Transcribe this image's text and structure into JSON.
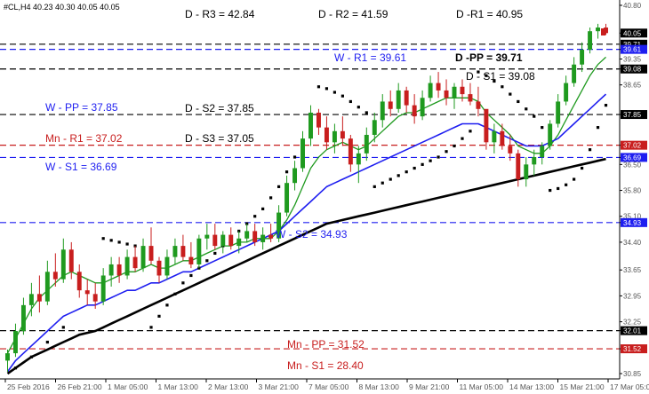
{
  "chart_data": {
    "type": "candlestick",
    "symbol_header": "#CL,H4  40.23 40.30 40.05 40.05",
    "ylim": [
      30.85,
      40.8
    ],
    "y_ticks": [
      "40.80",
      "40.05",
      "39.61",
      "39.35",
      "39.08",
      "38.65",
      "37.85",
      "37.02",
      "36.69",
      "36.50",
      "35.80",
      "35.10",
      "34.93",
      "34.40",
      "33.65",
      "32.95",
      "32.25",
      "32.01",
      "31.52",
      "30.85"
    ],
    "y_tick_values": [
      40.8,
      40.05,
      39.61,
      39.35,
      39.08,
      38.65,
      37.85,
      37.02,
      36.69,
      36.5,
      35.8,
      35.1,
      34.93,
      34.4,
      33.65,
      32.95,
      32.25,
      32.01,
      31.52,
      30.85
    ],
    "highlight_ticks": [
      {
        "label": "40.05",
        "value": 40.05,
        "bg": "#000000",
        "fg": "#ffffff"
      },
      {
        "label": "39.71",
        "value": 39.75,
        "bg": "#000000",
        "fg": "#ffffff"
      },
      {
        "label": "39.61",
        "value": 39.61,
        "bg": "#1e1ef0",
        "fg": "#ffffff"
      },
      {
        "label": "39.08",
        "value": 39.08,
        "bg": "#000000",
        "fg": "#ffffff"
      },
      {
        "label": "37.85",
        "value": 37.85,
        "bg": "#000000",
        "fg": "#ffffff"
      },
      {
        "label": "37.02",
        "value": 37.02,
        "bg": "#c81e1e",
        "fg": "#ffffff"
      },
      {
        "label": "36.69",
        "value": 36.69,
        "bg": "#1e1ef0",
        "fg": "#ffffff"
      },
      {
        "label": "34.93",
        "value": 34.93,
        "bg": "#1e1ef0",
        "fg": "#ffffff"
      },
      {
        "label": "32.01",
        "value": 32.01,
        "bg": "#000000",
        "fg": "#ffffff"
      },
      {
        "label": "31.52",
        "value": 31.52,
        "bg": "#c81e1e",
        "fg": "#ffffff"
      }
    ],
    "x_labels": [
      "25 Feb 2016",
      "26 Feb 21:00",
      "1 Mar 05:00",
      "1 Mar 13:00",
      "2 Mar 13:00",
      "3 Mar 21:00",
      "7 Mar 05:00",
      "8 Mar 13:00",
      "9 Mar 21:00",
      "11 Mar 05:00",
      "14 Mar 13:00",
      "15 Mar 21:00",
      "17 Mar 05:00"
    ],
    "pivot_levels": [
      {
        "label": "D - R3 = 42.84",
        "value": 42.84,
        "color": "#000000",
        "line": false
      },
      {
        "label": "D - R2 = 41.59",
        "value": 41.59,
        "color": "#000000",
        "line": false
      },
      {
        "label": "D -R1 = 40.95",
        "value": 40.95,
        "color": "#000000",
        "line": false
      },
      {
        "label": "D -PP = 39.71",
        "value": 39.75,
        "color": "#000000",
        "line": true,
        "bold": true
      },
      {
        "label": "W - R1 = 39.61",
        "value": 39.61,
        "color": "#1e1ef0",
        "line": true
      },
      {
        "label": "D - S1 = 39.08",
        "value": 39.08,
        "color": "#000000",
        "line": true
      },
      {
        "label": "W - PP = 37.85",
        "value": 37.85,
        "color": "#1e1ef0",
        "line": false
      },
      {
        "label": "D - S2 = 37.85",
        "value": 37.85,
        "color": "#000000",
        "line": true
      },
      {
        "label": "Mn - R1 = 37.02",
        "value": 37.02,
        "color": "#c81e1e",
        "line": true
      },
      {
        "label": "D - S3 = 37.05",
        "value": 37.05,
        "color": "#000000",
        "line": false
      },
      {
        "label": "W - S1 = 36.69",
        "value": 36.69,
        "color": "#1e1ef0",
        "line": true
      },
      {
        "label": "W - S2 = 34.93",
        "value": 34.93,
        "color": "#1e1ef0",
        "line": true
      },
      {
        "label": "Mn - PP = 31.52",
        "value": 31.52,
        "color": "#c81e1e",
        "line": true
      },
      {
        "label": "Mn - S1 = 28.40",
        "value": 28.4,
        "color": "#c81e1e",
        "line": false
      },
      {
        "label": "",
        "value": 32.01,
        "color": "#000000",
        "line": true
      }
    ],
    "candles": [
      [
        31.2,
        31.5,
        30.9,
        31.4
      ],
      [
        31.4,
        32.2,
        31.3,
        32.0
      ],
      [
        32.0,
        32.9,
        31.9,
        32.7
      ],
      [
        32.7,
        33.3,
        32.4,
        33.0
      ],
      [
        33.0,
        33.5,
        32.5,
        32.8
      ],
      [
        32.8,
        33.9,
        32.7,
        33.6
      ],
      [
        33.6,
        34.1,
        33.2,
        33.4
      ],
      [
        33.4,
        34.5,
        33.3,
        34.2
      ],
      [
        34.2,
        34.4,
        33.4,
        33.6
      ],
      [
        33.6,
        33.8,
        32.9,
        33.1
      ],
      [
        33.1,
        33.4,
        32.7,
        33.0
      ],
      [
        33.0,
        33.3,
        32.6,
        32.8
      ],
      [
        32.8,
        33.7,
        32.7,
        33.5
      ],
      [
        33.5,
        34.0,
        33.2,
        33.8
      ],
      [
        33.8,
        34.0,
        33.3,
        33.5
      ],
      [
        33.5,
        34.2,
        33.4,
        34.0
      ],
      [
        34.0,
        34.3,
        33.6,
        33.7
      ],
      [
        33.7,
        34.5,
        33.6,
        34.3
      ],
      [
        34.3,
        34.8,
        33.8,
        33.9
      ],
      [
        33.9,
        34.0,
        33.3,
        33.5
      ],
      [
        33.5,
        34.2,
        33.4,
        34.0
      ],
      [
        34.0,
        34.5,
        33.8,
        34.3
      ],
      [
        34.3,
        34.6,
        33.9,
        34.0
      ],
      [
        34.0,
        34.4,
        33.7,
        33.8
      ],
      [
        33.8,
        34.6,
        33.7,
        34.5
      ],
      [
        34.5,
        34.9,
        34.2,
        34.6
      ],
      [
        34.6,
        34.9,
        34.2,
        34.3
      ],
      [
        34.3,
        34.7,
        34.1,
        34.6
      ],
      [
        34.6,
        34.8,
        34.2,
        34.3
      ],
      [
        34.3,
        34.7,
        34.1,
        34.5
      ],
      [
        34.5,
        34.9,
        34.4,
        34.7
      ],
      [
        34.7,
        34.9,
        34.3,
        34.4
      ],
      [
        34.4,
        34.8,
        34.2,
        34.6
      ],
      [
        34.6,
        34.9,
        34.4,
        34.5
      ],
      [
        34.5,
        35.4,
        34.4,
        35.2
      ],
      [
        35.2,
        36.2,
        35.1,
        36.0
      ],
      [
        36.0,
        36.6,
        35.8,
        36.4
      ],
      [
        36.4,
        37.4,
        36.3,
        37.2
      ],
      [
        37.2,
        38.1,
        37.0,
        37.9
      ],
      [
        37.9,
        38.0,
        37.3,
        37.5
      ],
      [
        37.5,
        37.8,
        36.9,
        37.1
      ],
      [
        37.1,
        37.6,
        36.8,
        37.4
      ],
      [
        37.4,
        37.8,
        37.0,
        37.2
      ],
      [
        37.2,
        37.3,
        36.3,
        36.5
      ],
      [
        36.5,
        37.0,
        36.0,
        36.8
      ],
      [
        36.8,
        37.5,
        36.6,
        37.3
      ],
      [
        37.3,
        37.9,
        37.1,
        37.7
      ],
      [
        37.7,
        38.4,
        37.5,
        38.2
      ],
      [
        38.2,
        38.5,
        37.8,
        38.0
      ],
      [
        38.0,
        38.7,
        37.9,
        38.5
      ],
      [
        38.5,
        38.6,
        37.9,
        38.1
      ],
      [
        38.1,
        38.4,
        37.6,
        37.8
      ],
      [
        37.8,
        38.5,
        37.7,
        38.3
      ],
      [
        38.3,
        38.9,
        38.2,
        38.7
      ],
      [
        38.7,
        39.0,
        38.3,
        38.5
      ],
      [
        38.5,
        38.8,
        38.1,
        38.3
      ],
      [
        38.3,
        38.7,
        38.0,
        38.6
      ],
      [
        38.6,
        38.8,
        38.2,
        38.4
      ],
      [
        38.4,
        38.7,
        38.1,
        38.2
      ],
      [
        38.2,
        38.6,
        37.8,
        38.0
      ],
      [
        38.0,
        37.9,
        36.9,
        37.1
      ],
      [
        37.1,
        37.6,
        36.8,
        37.4
      ],
      [
        37.4,
        37.6,
        36.9,
        37.0
      ],
      [
        37.0,
        37.3,
        36.6,
        36.8
      ],
      [
        36.8,
        36.9,
        35.9,
        36.1
      ],
      [
        36.1,
        36.7,
        35.9,
        36.5
      ],
      [
        36.5,
        36.9,
        36.2,
        36.7
      ],
      [
        36.7,
        37.1,
        36.5,
        37.0
      ],
      [
        37.0,
        37.7,
        36.9,
        37.6
      ],
      [
        37.6,
        38.4,
        37.5,
        38.2
      ],
      [
        38.2,
        38.9,
        38.1,
        38.7
      ],
      [
        38.7,
        39.4,
        38.6,
        39.2
      ],
      [
        39.2,
        39.8,
        39.0,
        39.6
      ],
      [
        39.6,
        40.2,
        39.5,
        40.1
      ],
      [
        40.1,
        40.3,
        39.9,
        40.2
      ],
      [
        40.2,
        40.3,
        40.0,
        40.05
      ]
    ],
    "series": [
      {
        "color": "#1f9a1f",
        "width": 1.3,
        "values": [
          31.4,
          31.8,
          32.2,
          32.6,
          32.9,
          33.1,
          33.3,
          33.5,
          33.6,
          33.5,
          33.4,
          33.3,
          33.3,
          33.4,
          33.5,
          33.6,
          33.6,
          33.7,
          33.8,
          33.7,
          33.7,
          33.8,
          33.9,
          33.9,
          34.0,
          34.1,
          34.2,
          34.3,
          34.3,
          34.4,
          34.4,
          34.5,
          34.5,
          34.5,
          34.7,
          35.0,
          35.4,
          35.9,
          36.4,
          36.7,
          36.9,
          37.0,
          37.1,
          37.0,
          36.9,
          37.0,
          37.2,
          37.4,
          37.6,
          37.8,
          37.9,
          37.9,
          38.0,
          38.1,
          38.2,
          38.3,
          38.3,
          38.3,
          38.3,
          38.2,
          37.9,
          37.7,
          37.5,
          37.3,
          37.0,
          36.9,
          36.8,
          36.8,
          37.0,
          37.3,
          37.7,
          38.1,
          38.5,
          38.9,
          39.2,
          39.4
        ]
      },
      {
        "color": "#1e1ef0",
        "width": 1.6,
        "values": [
          30.9,
          31.2,
          31.4,
          31.6,
          31.8,
          32.0,
          32.2,
          32.4,
          32.5,
          32.6,
          32.7,
          32.7,
          32.8,
          32.9,
          33.0,
          33.1,
          33.1,
          33.2,
          33.3,
          33.3,
          33.4,
          33.5,
          33.6,
          33.6,
          33.7,
          33.8,
          33.9,
          34.0,
          34.1,
          34.2,
          34.3,
          34.4,
          34.5,
          34.6,
          34.7,
          34.9,
          35.1,
          35.3,
          35.5,
          35.7,
          35.9,
          36.0,
          36.1,
          36.2,
          36.3,
          36.4,
          36.5,
          36.6,
          36.7,
          36.8,
          36.9,
          37.0,
          37.1,
          37.2,
          37.3,
          37.4,
          37.5,
          37.6,
          37.6,
          37.6,
          37.5,
          37.4,
          37.3,
          37.2,
          37.1,
          37.0,
          37.0,
          37.0,
          37.1,
          37.2,
          37.4,
          37.6,
          37.8,
          38.0,
          38.2,
          38.4
        ]
      },
      {
        "color": "#000000",
        "width": 2.6,
        "values": [
          30.85,
          31.0,
          31.15,
          31.3,
          31.4,
          31.5,
          31.6,
          31.7,
          31.8,
          31.9,
          31.95,
          32.0,
          32.1,
          32.2,
          32.3,
          32.4,
          32.5,
          32.6,
          32.7,
          32.8,
          32.9,
          33.0,
          33.1,
          33.2,
          33.3,
          33.4,
          33.5,
          33.6,
          33.7,
          33.8,
          33.9,
          34.0,
          34.1,
          34.2,
          34.3,
          34.4,
          34.5,
          34.6,
          34.7,
          34.8,
          34.9,
          34.95,
          35.0,
          35.05,
          35.1,
          35.15,
          35.2,
          35.25,
          35.3,
          35.35,
          35.4,
          35.45,
          35.5,
          35.55,
          35.6,
          35.65,
          35.7,
          35.75,
          35.8,
          35.85,
          35.9,
          35.95,
          36.0,
          36.05,
          36.1,
          36.15,
          36.2,
          36.25,
          36.3,
          36.35,
          36.4,
          36.45,
          36.5,
          36.55,
          36.6,
          36.65
        ]
      }
    ],
    "parabolic_sar": [
      [
        1,
        31.0
      ],
      [
        3,
        31.3
      ],
      [
        5,
        31.7
      ],
      [
        7,
        32.1
      ],
      [
        12,
        34.5
      ],
      [
        13,
        34.45
      ],
      [
        14,
        34.4
      ],
      [
        15,
        34.35
      ],
      [
        16,
        34.3
      ],
      [
        17,
        34.2
      ],
      [
        18,
        32.1
      ],
      [
        19,
        32.4
      ],
      [
        20,
        32.7
      ],
      [
        21,
        33.0
      ],
      [
        22,
        33.3
      ],
      [
        23,
        33.5
      ],
      [
        24,
        33.7
      ],
      [
        25,
        33.9
      ],
      [
        26,
        34.1
      ],
      [
        27,
        34.3
      ],
      [
        28,
        34.5
      ],
      [
        29,
        34.7
      ],
      [
        30,
        34.9
      ],
      [
        31,
        35.1
      ],
      [
        32,
        35.3
      ],
      [
        33,
        35.6
      ],
      [
        34,
        35.9
      ],
      [
        35,
        36.3
      ],
      [
        36,
        36.7
      ],
      [
        37,
        37.1
      ],
      [
        38,
        37.5
      ],
      [
        39,
        38.6
      ],
      [
        40,
        38.55
      ],
      [
        41,
        38.45
      ],
      [
        42,
        38.35
      ],
      [
        43,
        38.2
      ],
      [
        44,
        38.05
      ],
      [
        45,
        37.9
      ],
      [
        46,
        35.9
      ],
      [
        47,
        36.0
      ],
      [
        48,
        36.1
      ],
      [
        49,
        36.2
      ],
      [
        50,
        36.3
      ],
      [
        51,
        36.4
      ],
      [
        52,
        36.5
      ],
      [
        53,
        36.6
      ],
      [
        54,
        36.7
      ],
      [
        55,
        36.85
      ],
      [
        56,
        37.0
      ],
      [
        57,
        37.2
      ],
      [
        58,
        37.4
      ],
      [
        59,
        39.0
      ],
      [
        60,
        38.9
      ],
      [
        61,
        38.75
      ],
      [
        62,
        38.6
      ],
      [
        63,
        38.4
      ],
      [
        64,
        38.2
      ],
      [
        65,
        38.0
      ],
      [
        66,
        37.8
      ],
      [
        67,
        37.5
      ],
      [
        68,
        35.8
      ],
      [
        69,
        35.85
      ],
      [
        70,
        35.95
      ],
      [
        71,
        36.1
      ],
      [
        72,
        36.4
      ],
      [
        73,
        36.9
      ],
      [
        74,
        37.5
      ],
      [
        75,
        38.1
      ]
    ]
  }
}
